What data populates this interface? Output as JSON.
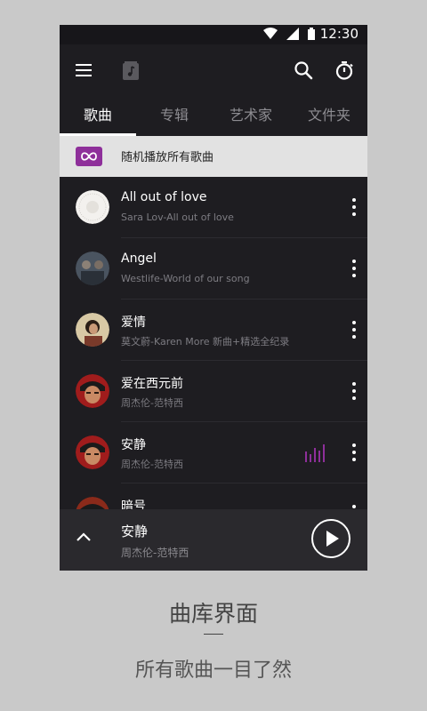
{
  "status_bar": {
    "time": "12:30"
  },
  "tabs": [
    {
      "label": "歌曲",
      "active": true
    },
    {
      "label": "专辑",
      "active": false
    },
    {
      "label": "艺术家",
      "active": false
    },
    {
      "label": "文件夹",
      "active": false
    }
  ],
  "shuffle": {
    "label": "随机播放所有歌曲"
  },
  "songs": [
    {
      "title": "All out of love",
      "subtitle": "Sara Lov-All out of love"
    },
    {
      "title": "Angel",
      "subtitle": "Westlife-World of our song"
    },
    {
      "title": "爱情",
      "subtitle": "莫文蔚-Karen More 新曲+精选全纪录"
    },
    {
      "title": "爱在西元前",
      "subtitle": "周杰伦-范特西"
    },
    {
      "title": "安静",
      "subtitle": "周杰伦-范特西",
      "playing": true
    },
    {
      "title": "暗号",
      "subtitle": ""
    }
  ],
  "now_playing": {
    "title": "安静",
    "subtitle": "周杰伦-范特西"
  },
  "captions": {
    "heading": "曲库界面",
    "subheading": "所有歌曲一目了然"
  },
  "colors": {
    "accent": "#8e2f9a",
    "background": "#1e1d21",
    "page_bg": "#c9c9c9"
  },
  "icons": {
    "menu": "menu-icon",
    "library": "music-library-icon",
    "search": "search-icon",
    "timer": "sleep-timer-icon",
    "shuffle": "infinity-shuffle-icon",
    "more": "more-vertical-icon",
    "equalizer": "equalizer-icon",
    "expand": "chevron-up-icon",
    "play": "play-icon"
  }
}
